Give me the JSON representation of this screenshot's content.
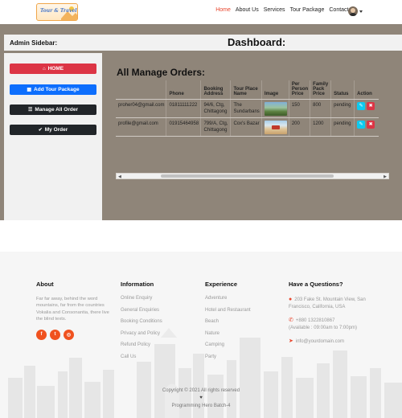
{
  "navbar": {
    "logo_text": "Tour & Travel",
    "links": [
      "Home",
      "About Us",
      "Services",
      "Tour Package",
      "Contact Us"
    ],
    "active_link": "Home"
  },
  "dashboard": {
    "sidebar_title": "Admin Sidebar:",
    "title": "Dashboard:",
    "sidebar_buttons": {
      "home": "HOME",
      "add_tour": "Add Tour Package",
      "manage_all": "Manage All Order",
      "my_order": "My Order"
    }
  },
  "orders": {
    "title": "All Manage Orders:",
    "columns": [
      "",
      "Phone",
      "Booking Address",
      "Tour Place Name",
      "Image",
      "Per Person Price",
      "Family Pack Price",
      "Status",
      "Action"
    ],
    "rows": [
      {
        "email": "proher04@gmail.com",
        "phone": "01811111222",
        "address": "94/6, Ctg, Chittagong",
        "place": "The Sundarbans",
        "price_person": "150",
        "price_family": "800",
        "status": "pending"
      },
      {
        "email": "profile@gmail.com",
        "phone": "01915464958",
        "address": "799/A, Ctg, Chittagong",
        "place": "Cox's Bazar",
        "price_person": "200",
        "price_family": "1200",
        "status": "pending"
      }
    ]
  },
  "footer": {
    "about": {
      "heading": "About",
      "text": "Far far away, behind the word mountains, far from the countries Vokalia and Consonantia, there live the blind texts."
    },
    "information": {
      "heading": "Information",
      "links": [
        "Online Enquiry",
        "General Enquiries",
        "Booking Conditions",
        "Privacy and Policy",
        "Refund Policy",
        "Call Us"
      ]
    },
    "experience": {
      "heading": "Experience",
      "links": [
        "Adventure",
        "Hotel and Restaurant",
        "Beach",
        "Nature",
        "Camping",
        "Party"
      ]
    },
    "contact": {
      "heading": "Have a Questions?",
      "address": "203 Fake St. Mountain View, San Francisco, California, USA",
      "phone": "+880 1322810867",
      "hours": "(Available : 09:00am to 7:00pm)",
      "email": "info@yourdomain.com"
    },
    "copyright": "Copyright © 2021 All rights reserved",
    "credit": "Programming Hero Batch-4"
  },
  "colors": {
    "accent": "#e8452c",
    "dashboard_bg": "#8f8579",
    "panel_bg": "#f1f1f1"
  }
}
